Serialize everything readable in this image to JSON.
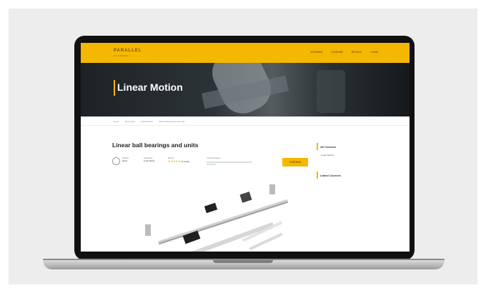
{
  "site": {
    "logo": "PARALLEL",
    "logo_sub": "ACADEMY",
    "nav": [
      "COURSES",
      "LESSONS",
      "DETAILS",
      "LOGIN"
    ]
  },
  "hero": {
    "title": "Linear Motion"
  },
  "breadcrumb": [
    "Home",
    "All Courses",
    "Linear Motion",
    "Linear ball bearings and units"
  ],
  "course": {
    "title": "Linear ball bearings and units",
    "teacher_label": "Teacher",
    "teacher_name": "Admin",
    "category_label": "Categories",
    "category": "Linear Motion",
    "review_label": "Review",
    "stars": "★★★★★",
    "reviews": "(0 review)",
    "progress_label": "Course Progress",
    "progress": 0,
    "status": "Not started",
    "enroll_button": "CONTINUE"
  },
  "sidebar": {
    "all_courses": "All Courses",
    "all_courses_link": "Linear Motion",
    "latest_courses": "Latest Courses"
  },
  "colors": {
    "brand": "#f5b800",
    "dark": "#111111",
    "hero": "#2c3337"
  }
}
